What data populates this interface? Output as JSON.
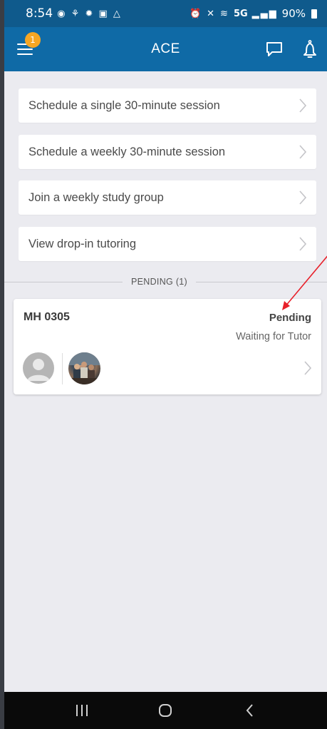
{
  "status_bar": {
    "time": "8:54",
    "left_icons": [
      "messenger-icon",
      "steam-icon",
      "bug-icon",
      "gallery-icon",
      "drive-icon"
    ],
    "network": "5G",
    "battery": "90%"
  },
  "app_bar": {
    "title": "ACE",
    "notification_count": "1",
    "accent": "#0f6aa6",
    "badge_color": "#f5a623"
  },
  "menu": {
    "items": [
      {
        "label": "Schedule a single 30-minute session"
      },
      {
        "label": "Schedule a weekly 30-minute session"
      },
      {
        "label": "Join a weekly study group"
      },
      {
        "label": "View drop-in tutoring"
      }
    ]
  },
  "pending_section": {
    "header": "PENDING (1)",
    "cards": [
      {
        "room": "MH 0305",
        "status": "Pending",
        "substatus": "Waiting for Tutor"
      }
    ]
  },
  "annotation": {
    "color": "#e8202a"
  }
}
